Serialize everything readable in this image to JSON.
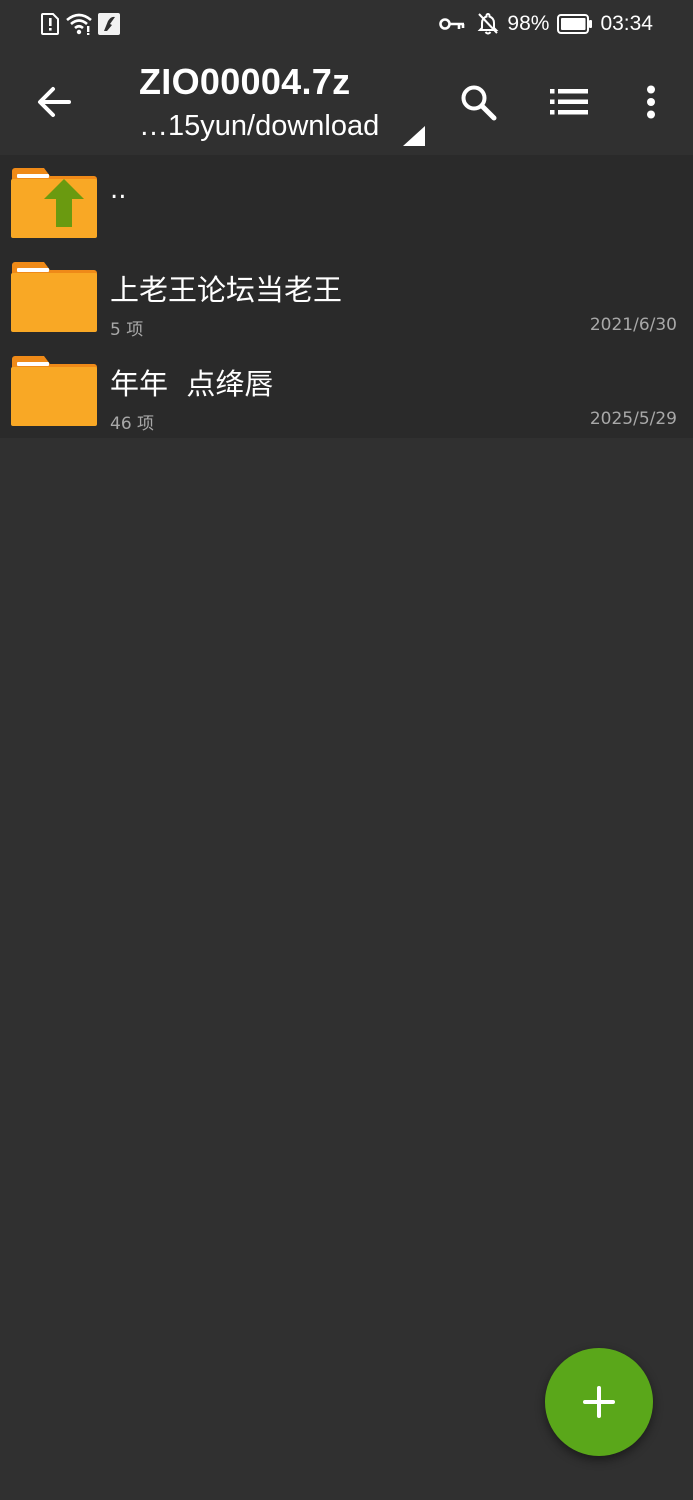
{
  "status_bar": {
    "battery_percent": "98%",
    "time": "03:34",
    "icons": [
      "alert-icon",
      "wifi-icon",
      "app-notification-icon",
      "vpn-key-icon",
      "bell-off-icon",
      "battery-icon"
    ]
  },
  "app_bar": {
    "title": "ZIO00004.7z",
    "path": "…15yun/download",
    "icons": [
      "back-arrow-icon",
      "search-icon",
      "list-view-icon",
      "more-vert-icon"
    ]
  },
  "files": [
    {
      "name": "..",
      "type": "parent-folder",
      "meta": "",
      "date": ""
    },
    {
      "name": "上老王论坛当老王",
      "type": "folder",
      "meta": "5 项",
      "date": "2021/6/30"
    },
    {
      "name": "年年  点绛唇",
      "type": "folder",
      "meta": "46 项",
      "date": "2025/5/29"
    }
  ],
  "fab": {
    "icon": "plus-icon"
  },
  "colors": {
    "background": "#303030",
    "list_background": "#2a2a2a",
    "folder": "#f9a825",
    "folder_dark": "#ef8a18",
    "up_arrow": "#6a9a10",
    "fab": "#5aa71a",
    "secondary_text": "#a8a8a8"
  }
}
